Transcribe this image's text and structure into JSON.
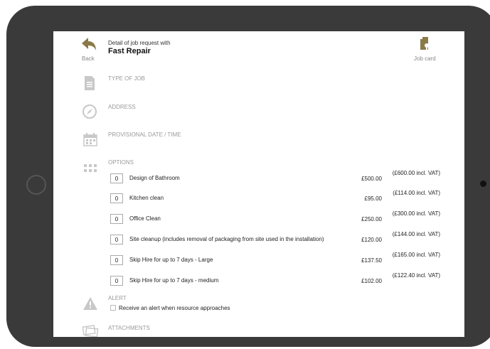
{
  "header": {
    "back_label": "Back",
    "subtitle": "Detail of job request with",
    "title": "Fast Repair",
    "job_card_label": "Job card"
  },
  "sections": {
    "type_of_job": "TYPE OF JOB",
    "address": "ADDRESS",
    "provisional_date": "PROVISIONAL DATE / TIME",
    "options": "OPTIONS",
    "alert": "ALERT",
    "attachments": "ATTACHMENTS"
  },
  "options": [
    {
      "qty": "0",
      "name": "Design of Bathroom",
      "price": "£500.00",
      "vat": "(£600.00 incl. VAT)"
    },
    {
      "qty": "0",
      "name": "Kitchen clean",
      "price": "£95.00",
      "vat": "(£114.00 incl. VAT)"
    },
    {
      "qty": "0",
      "name": "Office Clean",
      "price": "£250.00",
      "vat": "(£300.00 incl. VAT)"
    },
    {
      "qty": "0",
      "name": "Site cleanup (includes removal of packaging from site used in the installation)",
      "price": "£120.00",
      "vat": "(£144.00 incl. VAT)"
    },
    {
      "qty": "0",
      "name": "Skip Hire for up to 7 days - Large",
      "price": "£137.50",
      "vat": "(£165.00 incl. VAT)"
    },
    {
      "qty": "0",
      "name": "Skip Hire for up to 7 days - medium",
      "price": "£102.00",
      "vat": "(£122.40 incl. VAT)"
    }
  ],
  "alert": {
    "checkbox_label": "Receive an alert when resource approaches",
    "checked": false
  },
  "colors": {
    "back_arrow": "#8a7a48",
    "job_card_icon": "#8a7a48",
    "section_icon": "#c8c8c8",
    "device_frame": "#3a3a3a"
  },
  "icons": {
    "back": "back-arrow-icon",
    "job_card": "job-card-icon",
    "type_of_job": "document-icon",
    "address": "compass-icon",
    "date": "calendar-icon",
    "options": "grid-icon",
    "alert": "warning-icon",
    "attachments": "attachment-icon"
  }
}
